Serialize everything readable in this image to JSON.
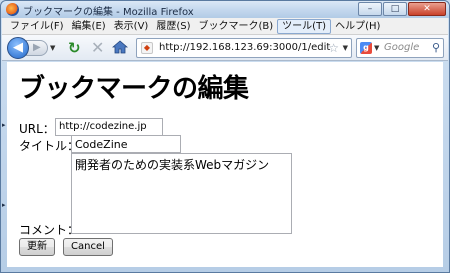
{
  "window": {
    "title": "ブックマークの編集 - Mozilla Firefox",
    "minimize_glyph": "–",
    "maximize_glyph": "□",
    "close_glyph": "✕"
  },
  "menu": {
    "items": [
      "ファイル(F)",
      "編集(E)",
      "表示(V)",
      "履歴(S)",
      "ブックマーク(B)",
      "ツール(T)",
      "ヘルプ(H)"
    ],
    "active_index": 5
  },
  "navigation": {
    "url": "http://192.168.123.69:3000/1/edit",
    "search_placeholder": "Google",
    "icons": [
      "back-arrow-icon",
      "forward-arrow-icon",
      "reload-icon",
      "stop-icon",
      "home-icon",
      "star-icon",
      "magnifier-icon"
    ]
  },
  "page": {
    "heading": "ブックマークの編集",
    "form": {
      "url_label": "URL：",
      "url_value": "http://codezine.jp",
      "title_label": "タイトル：",
      "title_value": "CodeZine",
      "comment_label": "コメント：",
      "comment_value": "開発者のための実装系Webマガジン",
      "submit_label": "更新",
      "cancel_label": "Cancel"
    }
  }
}
